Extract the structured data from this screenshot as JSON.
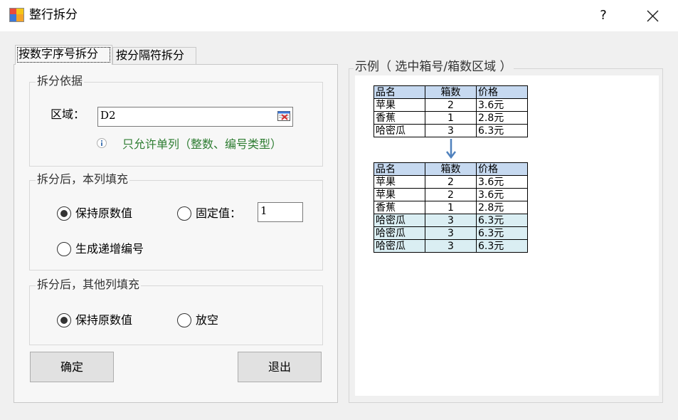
{
  "window": {
    "title": "整行拆分",
    "help_label": "?"
  },
  "tabs": [
    {
      "label": "按数字序号拆分"
    },
    {
      "label": "按分隔符拆分"
    }
  ],
  "split_basis": {
    "group_title": "拆分依据",
    "range_label": "区域：",
    "range_value": "D2",
    "hint": "只允许单列（整数、编号类型）"
  },
  "this_column_fill": {
    "group_title": "拆分后，本列填充",
    "keep_original": "保持原数值",
    "fixed_value_label": "固定值：",
    "fixed_value": "1",
    "generate_increment": "生成递增编号",
    "selected": "keep_original"
  },
  "other_columns_fill": {
    "group_title": "拆分后，其他列填充",
    "keep_original": "保持原数值",
    "leave_empty": "放空",
    "selected": "keep_original"
  },
  "buttons": {
    "ok": "确定",
    "exit": "退出"
  },
  "example": {
    "title": "示例（ 选中箱号/箱数区域 ）",
    "headers": [
      "品名",
      "箱数",
      "价格"
    ],
    "before_rows": [
      [
        "苹果",
        "2",
        "3.6元"
      ],
      [
        "香蕉",
        "1",
        "2.8元"
      ],
      [
        "哈密瓜",
        "3",
        "6.3元"
      ]
    ],
    "after_rows": [
      [
        "苹果",
        "2",
        "3.6元"
      ],
      [
        "苹果",
        "2",
        "3.6元"
      ],
      [
        "香蕉",
        "1",
        "2.8元"
      ],
      [
        "哈密瓜",
        "3",
        "6.3元"
      ],
      [
        "哈密瓜",
        "3",
        "6.3元"
      ],
      [
        "哈密瓜",
        "3",
        "6.3元"
      ]
    ],
    "header_color": "#c6d9f0",
    "highlight_color": "#daeef3",
    "arrow_color": "#4f81bd"
  },
  "colors": {
    "hint_text": "#2e7d32",
    "info_icon": "#4a7ab5"
  }
}
